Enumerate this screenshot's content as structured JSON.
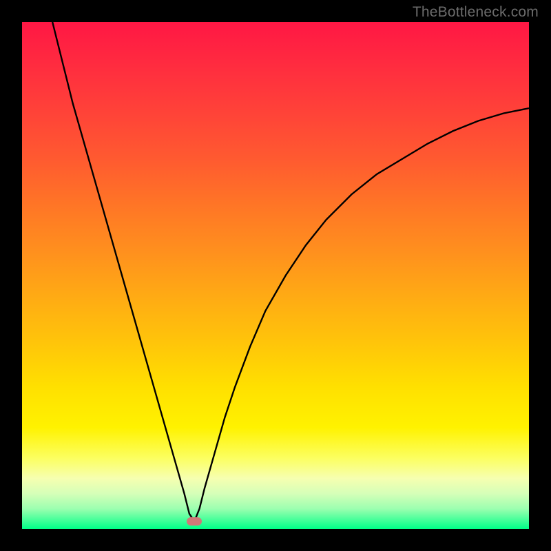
{
  "watermark": "TheBottleneck.com",
  "colors": {
    "frame": "#000000",
    "curve": "#000000",
    "marker": "#d07878",
    "gradient_top": "#ff1744",
    "gradient_mid": "#ffe000",
    "gradient_bottom": "#00ff88"
  },
  "chart_data": {
    "type": "line",
    "title": "",
    "xlabel": "",
    "ylabel": "",
    "xlim": [
      0,
      100
    ],
    "ylim": [
      0,
      100
    ],
    "grid": false,
    "legend": false,
    "annotations": [
      "TheBottleneck.com"
    ],
    "marker": {
      "x": 34,
      "y": 1.5
    },
    "series": [
      {
        "name": "left-branch",
        "x": [
          6,
          8,
          10,
          12,
          14,
          16,
          18,
          20,
          22,
          24,
          26,
          28,
          30,
          32,
          33,
          34
        ],
        "values": [
          100,
          92,
          84,
          77,
          70,
          63,
          56,
          49,
          42,
          35,
          28,
          21,
          14,
          7,
          3,
          1.5
        ]
      },
      {
        "name": "right-branch",
        "x": [
          34,
          35,
          36,
          38,
          40,
          42,
          45,
          48,
          52,
          56,
          60,
          65,
          70,
          75,
          80,
          85,
          90,
          95,
          100
        ],
        "values": [
          1.5,
          4,
          8,
          15,
          22,
          28,
          36,
          43,
          50,
          56,
          61,
          66,
          70,
          73,
          76,
          78.5,
          80.5,
          82,
          83
        ]
      }
    ]
  }
}
